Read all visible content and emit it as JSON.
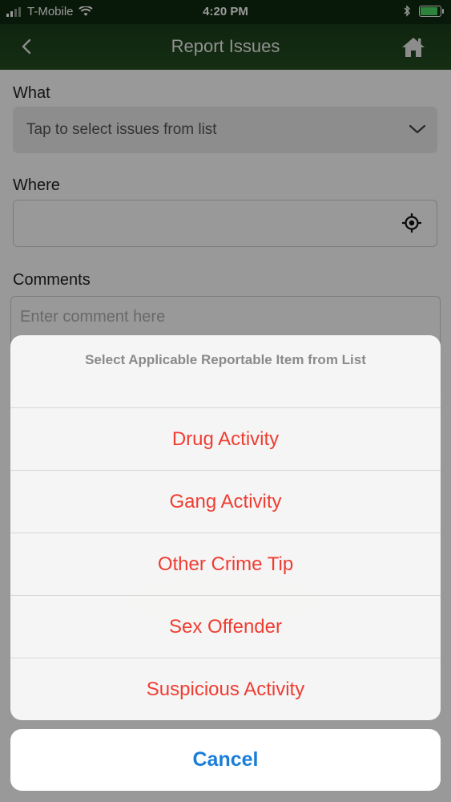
{
  "status_bar": {
    "carrier": "T-Mobile",
    "time": "4:20 PM"
  },
  "nav": {
    "title": "Report Issues",
    "back_icon": "chevron-left-icon",
    "home_icon": "home-icon"
  },
  "form": {
    "what_label": "What",
    "what_placeholder": "Tap to select issues from list",
    "where_label": "Where",
    "where_value": "",
    "comments_label": "Comments",
    "comments_placeholder": "Enter comment here"
  },
  "action_sheet": {
    "header": "Select Applicable Reportable Item from List",
    "items": [
      "Drug Activity",
      "Gang Activity",
      "Other Crime Tip",
      "Sex Offender",
      "Suspicious Activity"
    ],
    "cancel_label": "Cancel"
  },
  "colors": {
    "nav_bg": "#234d20",
    "item_text": "#ef3d32",
    "cancel_text": "#1a7ed8"
  }
}
